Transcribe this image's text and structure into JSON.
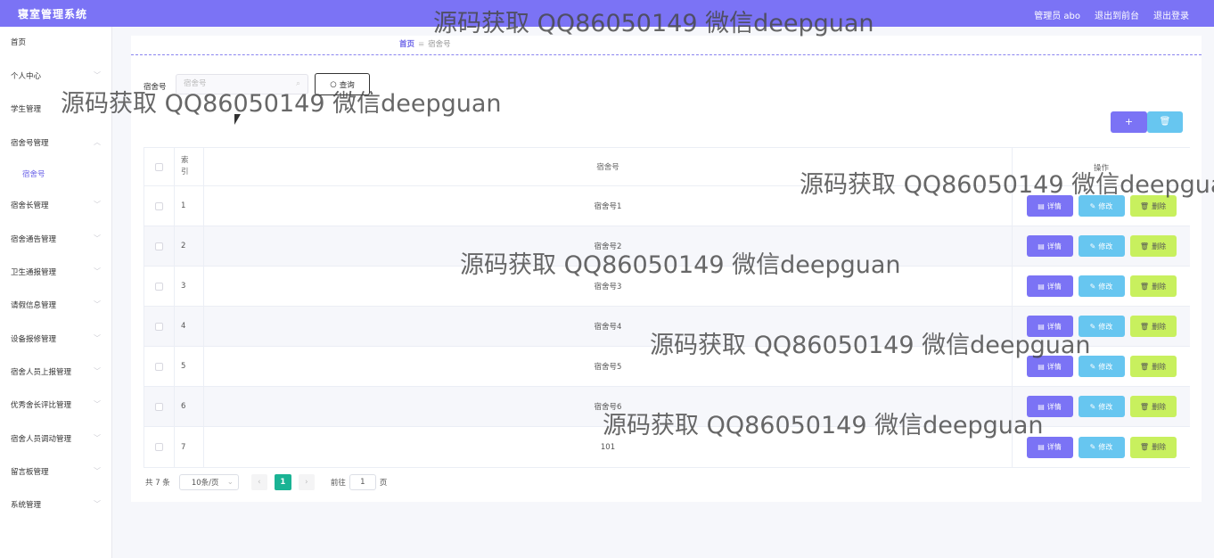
{
  "app": {
    "title": "寝室管理系统"
  },
  "header": {
    "user": "管理员 abo",
    "to_front": "退出到前台",
    "logout": "退出登录"
  },
  "sidebar": {
    "items": [
      {
        "label": "首页",
        "chevron": ""
      },
      {
        "label": "个人中心",
        "chevron": "﹀"
      },
      {
        "label": "学生管理",
        "chevron": "﹀"
      },
      {
        "label": "宿舍号管理",
        "chevron": "︿"
      },
      {
        "label": "宿舍号",
        "chevron": ""
      },
      {
        "label": "宿舍长管理",
        "chevron": "﹀"
      },
      {
        "label": "宿舍通告管理",
        "chevron": "﹀"
      },
      {
        "label": "卫生通报管理",
        "chevron": "﹀"
      },
      {
        "label": "请假信息管理",
        "chevron": "﹀"
      },
      {
        "label": "设备报修管理",
        "chevron": "﹀"
      },
      {
        "label": "宿舍人员上报管理",
        "chevron": "﹀"
      },
      {
        "label": "优秀舍长评比管理",
        "chevron": "﹀"
      },
      {
        "label": "宿舍人员调动管理",
        "chevron": "﹀"
      },
      {
        "label": "留言板管理",
        "chevron": "﹀"
      },
      {
        "label": "系统管理",
        "chevron": "﹀"
      }
    ]
  },
  "breadcrumb": {
    "home": "首页",
    "separator": "≡",
    "current": "宿舍号"
  },
  "search": {
    "label": "宿舍号",
    "placeholder": "宿舍号",
    "button": "查询"
  },
  "toolbar": {
    "add": "+",
    "delete": "🗑"
  },
  "table": {
    "headers": {
      "index": "索引",
      "name": "宿舍号",
      "ops": "操作"
    },
    "rows": [
      {
        "index": "1",
        "name": "宿舍号1"
      },
      {
        "index": "2",
        "name": "宿舍号2"
      },
      {
        "index": "3",
        "name": "宿舍号3"
      },
      {
        "index": "4",
        "name": "宿舍号4"
      },
      {
        "index": "5",
        "name": "宿舍号5"
      },
      {
        "index": "6",
        "name": "宿舍号6"
      },
      {
        "index": "7",
        "name": "101"
      }
    ],
    "ops": {
      "detail": "详情",
      "edit": "修改",
      "delete": "删除"
    }
  },
  "pagination": {
    "total": "共 7 条",
    "size": "10条/页",
    "prev": "‹",
    "page": "1",
    "next": "›",
    "goto": "前往",
    "goto_value": "1",
    "page_unit": "页"
  },
  "watermark": {
    "text": "源码获取 QQ86050149 微信deepguan"
  }
}
